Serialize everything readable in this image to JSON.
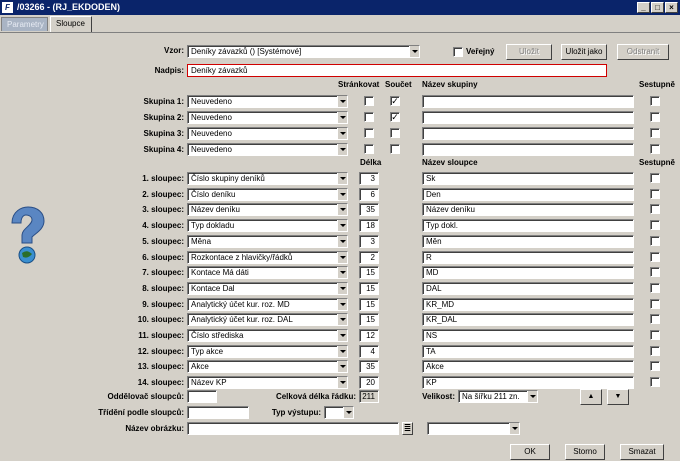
{
  "window": {
    "title": "/03266 - (RJ_EKDODEN)"
  },
  "tabs": [
    {
      "label": "Parametry"
    },
    {
      "label": "Sloupce"
    }
  ],
  "form": {
    "vzor_label": "Vzor:",
    "vzor_value": "Deníky závazků   ()   [Systémové]",
    "verejny_label": "Veřejný",
    "btn_ulozit": "Uložit",
    "btn_ulozit_jako": "Uložit jako",
    "btn_odstranit": "Odstranit",
    "nadpis_label": "Nadpis:",
    "nadpis_value": "Deníky závazků"
  },
  "group_headers": {
    "strankovat": "Stránkovat",
    "soucet": "Součet",
    "nazev_skupiny": "Název skupiny",
    "sestupne": "Sestupně"
  },
  "groups": [
    {
      "label": "Skupina 1:",
      "value": "Neuvedeno",
      "strankovat": "",
      "soucet": "✓",
      "name": "",
      "sestupne": ""
    },
    {
      "label": "Skupina 2:",
      "value": "Neuvedeno",
      "strankovat": "",
      "soucet": "✓",
      "name": "",
      "sestupne": ""
    },
    {
      "label": "Skupina 3:",
      "value": "Neuvedeno",
      "strankovat": "",
      "soucet": "",
      "name": "",
      "sestupne": ""
    },
    {
      "label": "Skupina 4:",
      "value": "Neuvedeno",
      "strankovat": "",
      "soucet": "",
      "name": "",
      "sestupne": ""
    }
  ],
  "column_headers": {
    "delka": "Délka",
    "nazev_sloupce": "Název sloupce",
    "sestupne": "Sestupně"
  },
  "columns": [
    {
      "label": "1. sloupec:",
      "value": "Číslo skupiny deníků",
      "length": "3",
      "name": "Sk"
    },
    {
      "label": "2. sloupec:",
      "value": "Číslo deníku",
      "length": "6",
      "name": "Den"
    },
    {
      "label": "3. sloupec:",
      "value": "Název deníku",
      "length": "35",
      "name": "Název deníku"
    },
    {
      "label": "4. sloupec:",
      "value": "Typ dokladu",
      "length": "18",
      "name": "Typ dokl."
    },
    {
      "label": "5. sloupec:",
      "value": "Měna",
      "length": "3",
      "name": "Měn"
    },
    {
      "label": "6. sloupec:",
      "value": "Rozkontace z hlavičky/řádků",
      "length": "2",
      "name": "R"
    },
    {
      "label": "7. sloupec:",
      "value": "Kontace Má dáti",
      "length": "15",
      "name": "MD"
    },
    {
      "label": "8. sloupec:",
      "value": "Kontace Dal",
      "length": "15",
      "name": "DAL"
    },
    {
      "label": "9. sloupec:",
      "value": "Analytický účet kur. roz. MD",
      "length": "15",
      "name": "KR_MD"
    },
    {
      "label": "10. sloupec:",
      "value": "Analytický účet kur. roz. DAL",
      "length": "15",
      "name": "KR_DAL"
    },
    {
      "label": "11. sloupec:",
      "value": "Číslo střediska",
      "length": "12",
      "name": "NS"
    },
    {
      "label": "12. sloupec:",
      "value": "Typ akce",
      "length": "4",
      "name": "TA"
    },
    {
      "label": "13. sloupec:",
      "value": "Akce",
      "length": "35",
      "name": "Akce"
    },
    {
      "label": "14. sloupec:",
      "value": "Název KP",
      "length": "20",
      "name": "KP"
    }
  ],
  "bottom": {
    "oddelovac_label": "Oddělovač sloupců:",
    "oddelovac_value": "",
    "celkova_label": "Celková délka řádku:",
    "celkova_value": "211",
    "velikost_label": "Velikost:",
    "velikost_value": "Na šířku 211 zn.",
    "trideni_label": "Třídění podle sloupců:",
    "trideni_value": "",
    "typ_vystupu_label": "Typ výstupu:",
    "typ_vystupu_value": "",
    "nazev_obrazku_label": "Název obrázku:",
    "nazev_obrazku_value": "",
    "obrazek_select_value": ""
  },
  "footer": {
    "ok": "OK",
    "storno": "Storno",
    "smazat": "Smazat"
  }
}
